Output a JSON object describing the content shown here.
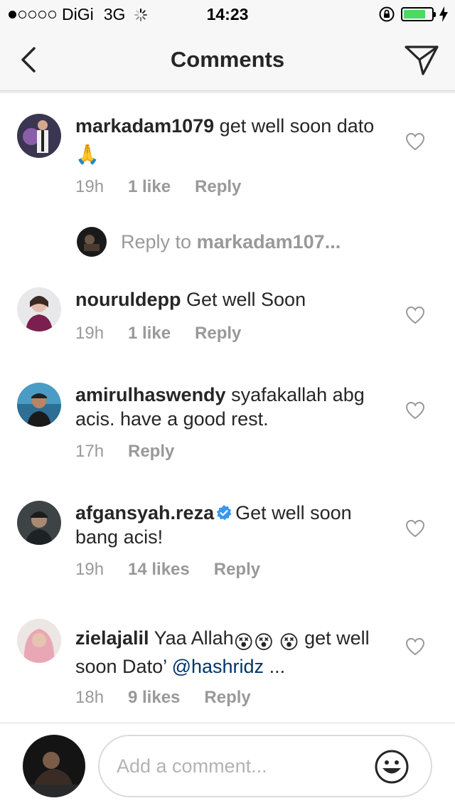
{
  "status_bar": {
    "carrier": "DiGi",
    "network": "3G",
    "time": "14:23",
    "signal_bars_filled": 1,
    "signal_bars_total": 5,
    "battery_level": 0.8,
    "battery_color": "#4cd964"
  },
  "nav": {
    "title": "Comments",
    "back_icon": "chevron-left-icon",
    "send_icon": "paper-plane-icon"
  },
  "comments": [
    {
      "username": "markadam1079",
      "text": "get well soon dato",
      "emoji": "🙏",
      "time": "19h",
      "likes": "1 like",
      "reply_label": "Reply"
    },
    {
      "username": "nouruldepp",
      "text": "Get well Soon",
      "time": "19h",
      "likes": "1 like",
      "reply_label": "Reply"
    },
    {
      "username": "amirulhaswendy",
      "text": "syafakallah abg acis. have a good rest.",
      "time": "17h",
      "reply_label": "Reply"
    },
    {
      "username": "afgansyah.reza",
      "verified": true,
      "text": "Get well soon bang acis!",
      "time": "19h",
      "likes": "14 likes",
      "reply_label": "Reply"
    },
    {
      "username": "zielajalil",
      "text_before": "Yaa Allah",
      "emoji": "😵😵 😵",
      "text_after": " get well soon Dato’ ",
      "mention": "@hashridz",
      "ellipsis": " ...",
      "time": "18h",
      "likes": "9 likes",
      "reply_label": "Reply"
    }
  ],
  "view_replies": {
    "prefix": "Reply to ",
    "target": "markadam107..."
  },
  "composer": {
    "placeholder": "Add a comment...",
    "value": "",
    "emoji_icon": "smiley-face-icon"
  },
  "colors": {
    "text": "#262626",
    "meta": "#999999",
    "mention": "#003569",
    "verified": "#3897f0",
    "bar_bg": "#f7f7f7"
  }
}
